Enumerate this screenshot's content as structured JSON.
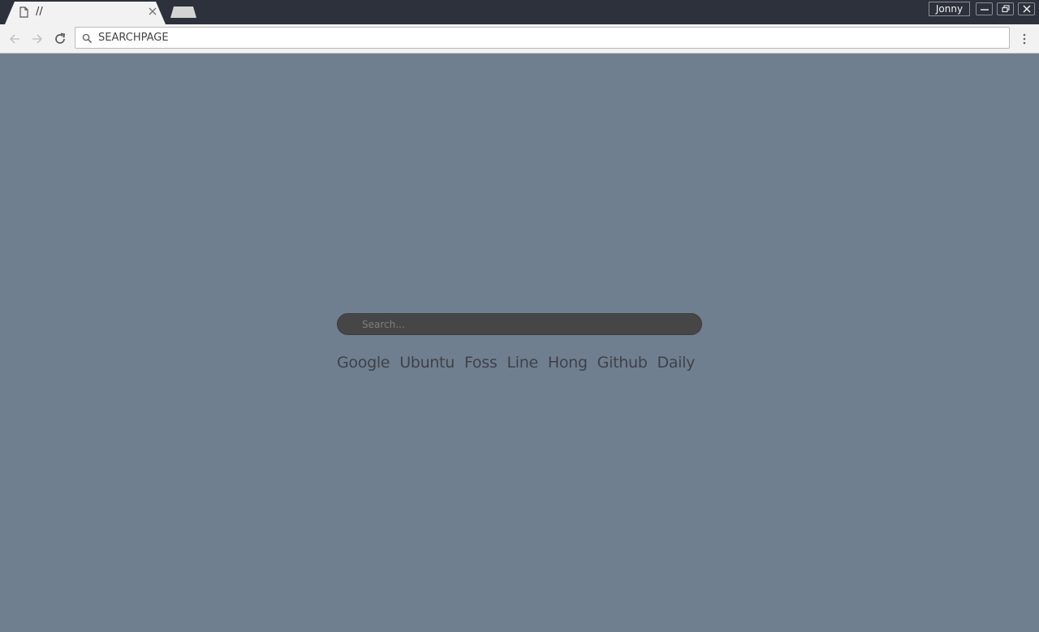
{
  "window": {
    "profile_name": "Jonny"
  },
  "tab": {
    "title": "//",
    "icon": "document-icon"
  },
  "toolbar": {
    "address": "SEARCHPAGE",
    "address_icon": "search-icon"
  },
  "search": {
    "placeholder": "Search..."
  },
  "links": [
    "Google",
    "Ubuntu",
    "Foss",
    "Line",
    "Hong",
    "Github",
    "Daily"
  ],
  "colors": {
    "page_background": "#707f8f",
    "titlebar": "#2d313c",
    "toolbar": "#f2f2f2",
    "search_box": "#464646",
    "link_text": "#3f4148"
  }
}
